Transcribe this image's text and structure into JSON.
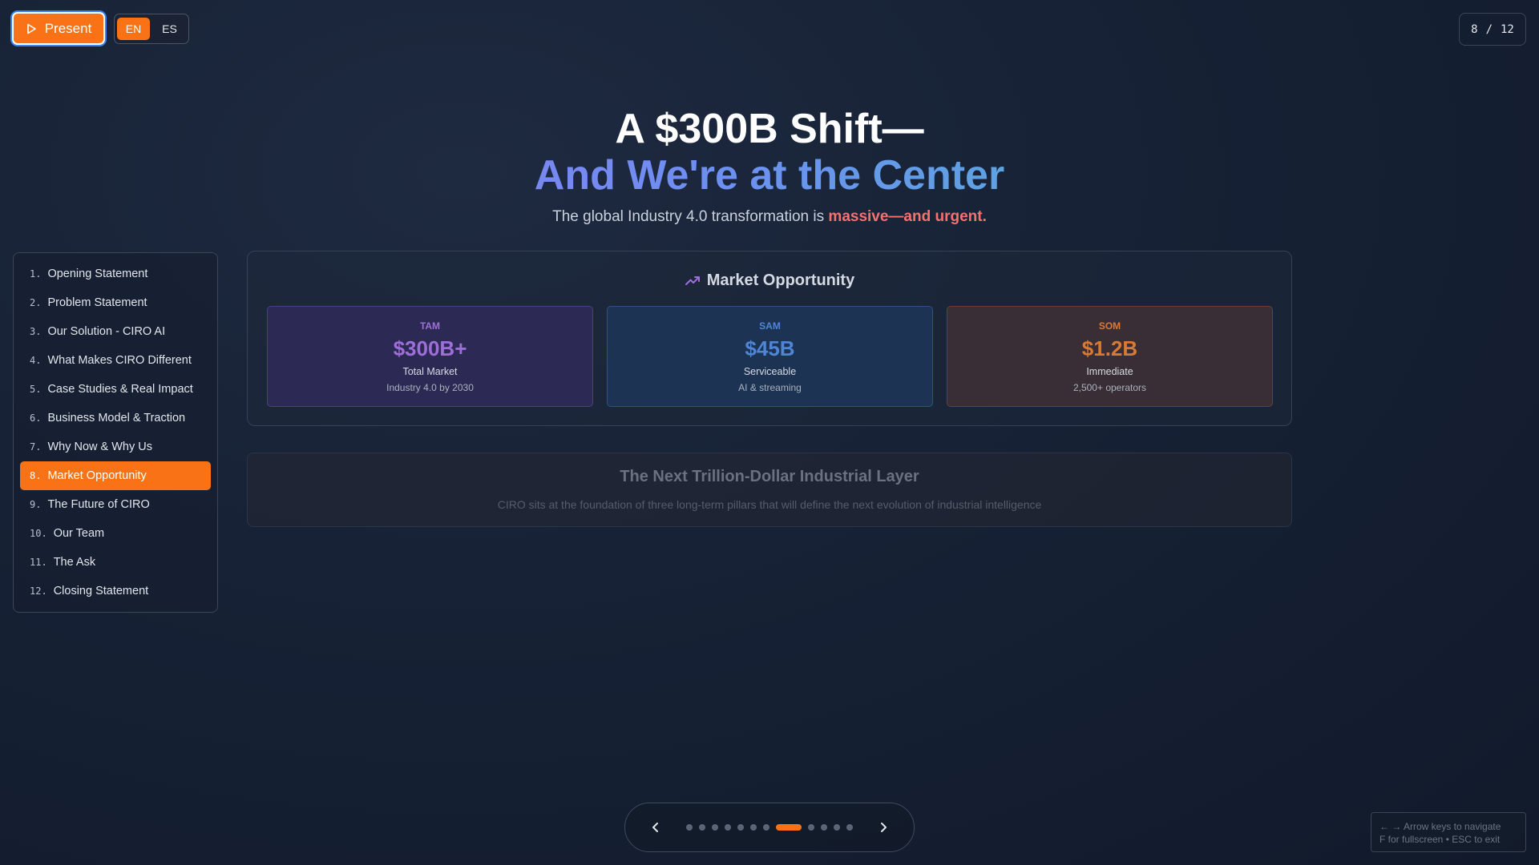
{
  "toolbar": {
    "present_label": "Present",
    "languages": [
      "EN",
      "ES"
    ],
    "active_language": "EN"
  },
  "counter": {
    "current": "8",
    "separator": "/",
    "total": "12"
  },
  "title": {
    "line1": "A $300B Shift—",
    "line2": "And We're at the Center",
    "subtitle_prefix": "The global Industry 4.0 transformation is ",
    "subtitle_highlight": "massive—and urgent."
  },
  "sidebar": {
    "items": [
      {
        "num": "1.",
        "label": "Opening Statement"
      },
      {
        "num": "2.",
        "label": "Problem Statement"
      },
      {
        "num": "3.",
        "label": "Our Solution - CIRO AI"
      },
      {
        "num": "4.",
        "label": "What Makes CIRO Different"
      },
      {
        "num": "5.",
        "label": "Case Studies & Real Impact"
      },
      {
        "num": "6.",
        "label": "Business Model & Traction"
      },
      {
        "num": "7.",
        "label": "Why Now & Why Us"
      },
      {
        "num": "8.",
        "label": "Market Opportunity"
      },
      {
        "num": "9.",
        "label": "The Future of CIRO"
      },
      {
        "num": "10.",
        "label": "Our Team"
      },
      {
        "num": "11.",
        "label": "The Ask"
      },
      {
        "num": "12.",
        "label": "Closing Statement"
      }
    ],
    "active_index": 7
  },
  "market": {
    "title": "Market Opportunity",
    "icon": "trending-up-icon",
    "metrics": [
      {
        "label": "TAM",
        "value": "$300B+",
        "desc": "Total Market",
        "sub": "Industry 4.0 by 2030",
        "color": "#9e6fd9"
      },
      {
        "label": "SAM",
        "value": "$45B",
        "desc": "Serviceable",
        "sub": "AI & streaming",
        "color": "#4f86d4"
      },
      {
        "label": "SOM",
        "value": "$1.2B",
        "desc": "Immediate",
        "sub": "2,500+ operators",
        "color": "#d97a33"
      }
    ]
  },
  "next_section": {
    "heading": "The Next Trillion-Dollar Industrial Layer",
    "text": "CIRO sits at the foundation of three long-term pillars that will define the next evolution of industrial intelligence"
  },
  "pager": {
    "total_slides": 12,
    "active_slide": 8
  },
  "hint": {
    "line1": "← → Arrow keys to navigate",
    "line2": "F for fullscreen • ESC to exit"
  },
  "colors": {
    "accent": "#f97316",
    "background": "#172236"
  }
}
